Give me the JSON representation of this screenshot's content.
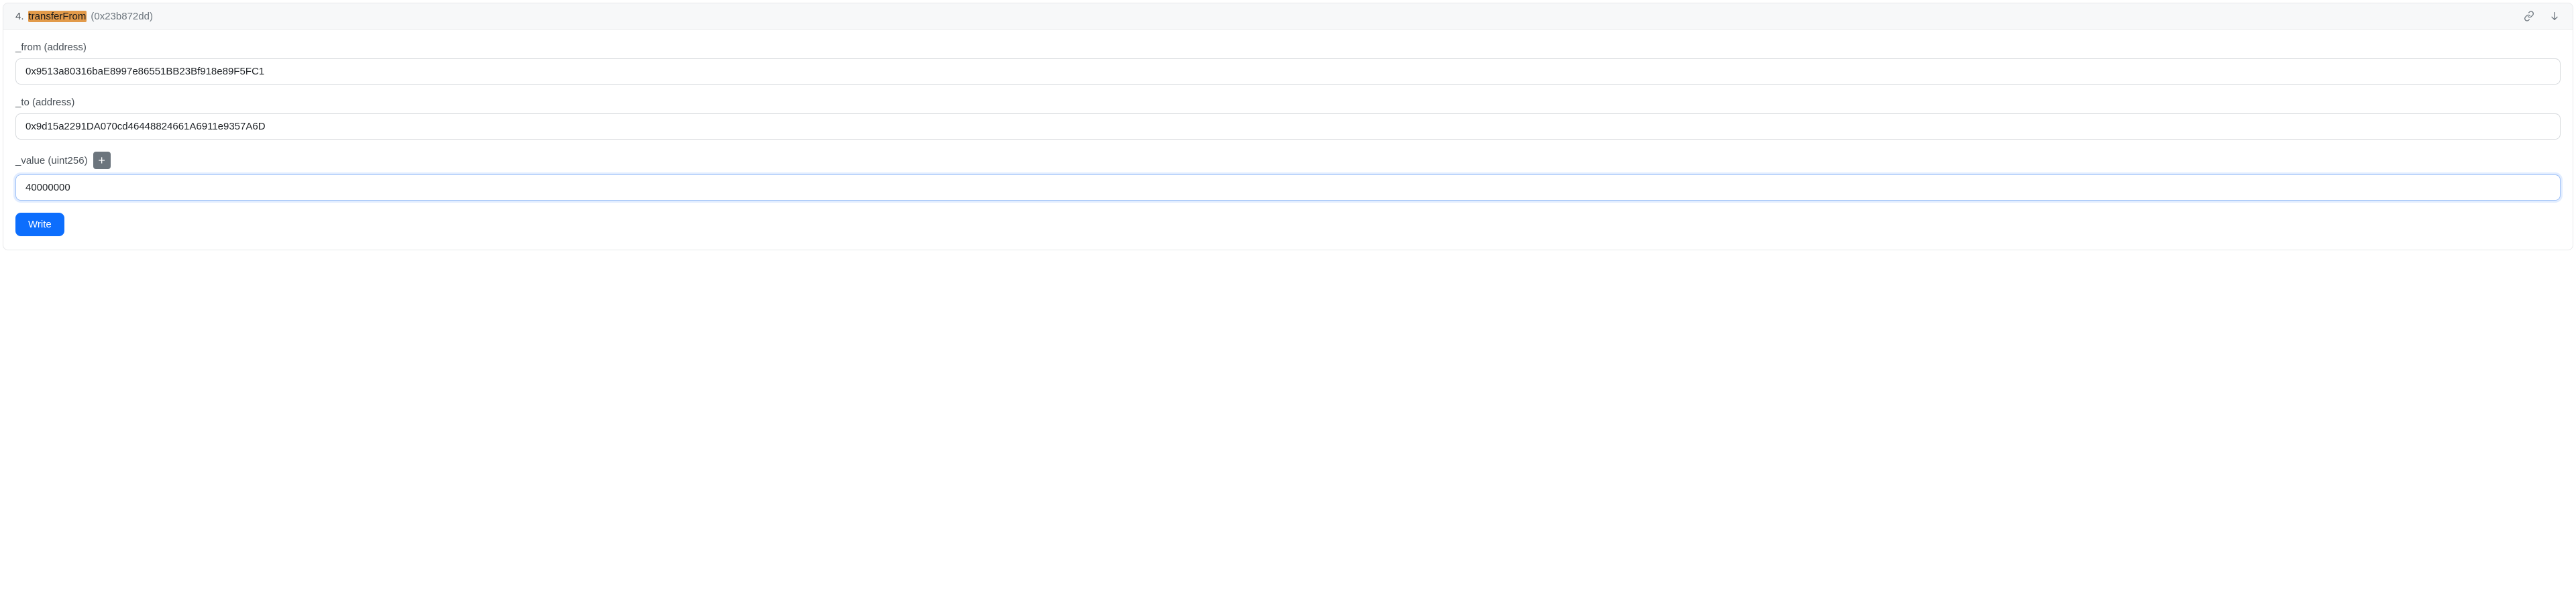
{
  "function": {
    "index": "4.",
    "name": "transferFrom",
    "hash": "(0x23b872dd)"
  },
  "fields": {
    "from": {
      "label": "_from (address)",
      "value": "0x9513a80316baE8997e86551BB23Bf918e89F5FC1"
    },
    "to": {
      "label": "_to (address)",
      "value": "0x9d15a2291DA070cd46448824661A6911e9357A6D"
    },
    "value": {
      "label": "_value (uint256)",
      "value": "40000000"
    }
  },
  "buttons": {
    "write": "Write",
    "plus": "+"
  }
}
